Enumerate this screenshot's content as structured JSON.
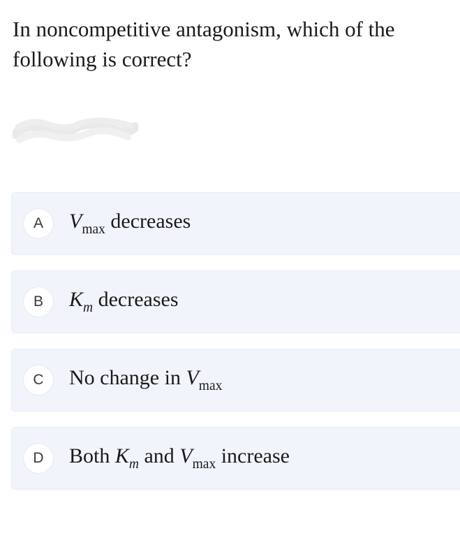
{
  "question": "In noncompetitive antagonism, which of the following is correct?",
  "options": {
    "a": {
      "letter": "A",
      "pre": "",
      "v1": "V",
      "s1": "max",
      "mid": " decreases",
      "v2": "",
      "s2": "",
      "post": ""
    },
    "b": {
      "letter": "B",
      "pre": "",
      "v1": "K",
      "s1": "m",
      "mid": " decreases",
      "v2": "",
      "s2": "",
      "post": ""
    },
    "c": {
      "letter": "C",
      "pre": "No change in ",
      "v1": "V",
      "s1": "max",
      "mid": "",
      "v2": "",
      "s2": "",
      "post": ""
    },
    "d": {
      "letter": "D",
      "pre": "Both ",
      "v1": "K",
      "s1": "m",
      "mid": " and ",
      "v2": "V",
      "s2": "max",
      "post": " increase"
    }
  }
}
